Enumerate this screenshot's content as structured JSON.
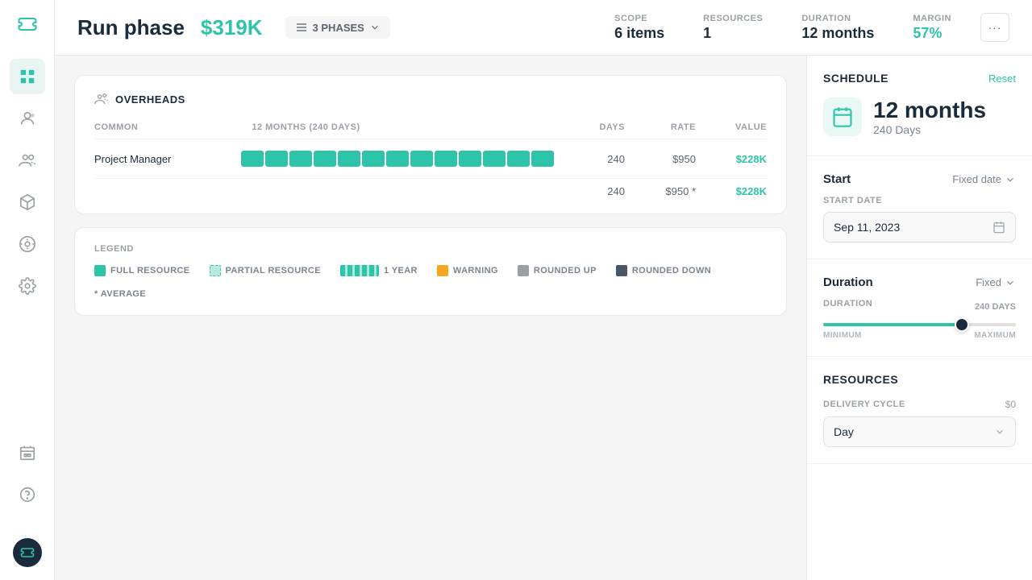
{
  "sidebar": {
    "logo_symbol": "≋",
    "items": [
      {
        "id": "dashboard",
        "icon": "grid-icon",
        "active": true
      },
      {
        "id": "users",
        "icon": "user-icon"
      },
      {
        "id": "team",
        "icon": "team-icon"
      },
      {
        "id": "box",
        "icon": "box-icon"
      },
      {
        "id": "chat",
        "icon": "chat-icon"
      },
      {
        "id": "settings",
        "icon": "settings-icon"
      },
      {
        "id": "building",
        "icon": "building-icon"
      },
      {
        "id": "help",
        "icon": "help-icon"
      }
    ],
    "avatar_symbol": "≋"
  },
  "header": {
    "title": "Run phase",
    "value": "$319K",
    "phases_label": "3 PHASES",
    "stats": {
      "scope_label": "SCOPE",
      "scope_value": "6 items",
      "resources_label": "RESOURCES",
      "resources_value": "1",
      "duration_label": "DURATION",
      "duration_value": "12 months",
      "margin_label": "MARGIN",
      "margin_value": "57%"
    },
    "more_button": "···"
  },
  "overheads": {
    "title": "OVERHEADS",
    "table_headers": {
      "common": "COMMON",
      "period": "12 MONTHS (240 DAYS)",
      "days": "DAYS",
      "rate": "RATE",
      "value": "VALUE"
    },
    "rows": [
      {
        "name": "Project Manager",
        "days": "240",
        "rate": "$950",
        "value": "$228K",
        "bars": 13
      }
    ],
    "footer": {
      "days": "240",
      "rate": "$950 *",
      "value": "$228K"
    }
  },
  "legend": {
    "title": "LEGEND",
    "items": [
      {
        "id": "full",
        "label": "FULL RESOURCE"
      },
      {
        "id": "partial",
        "label": "PARTIAL RESOURCE"
      },
      {
        "id": "one-year",
        "label": "1 YEAR"
      },
      {
        "id": "warning",
        "label": "WARNING"
      },
      {
        "id": "rounded-up",
        "label": "ROUNDED UP"
      },
      {
        "id": "rounded-down",
        "label": "ROUNDED DOWN"
      },
      {
        "id": "average",
        "label": "* AVERAGE"
      }
    ]
  },
  "schedule": {
    "section_title": "SCHEDULE",
    "reset_label": "Reset",
    "months": "12 months",
    "days": "240 Days",
    "start_label": "Start",
    "start_type": "Fixed date",
    "start_date_label": "START DATE",
    "start_date": "Sep 11, 2023",
    "duration_label": "Duration",
    "duration_type": "Fixed",
    "duration_days_label": "DURATION",
    "duration_days": "240 DAYS",
    "slider_min": "MINIMUM",
    "slider_max": "MAXIMUM",
    "slider_fill_pct": 72
  },
  "resources": {
    "section_title": "Resources",
    "delivery_cycle_label": "DELIVERY CYCLE",
    "delivery_cycle_value": "$0",
    "day_select": "Day"
  }
}
